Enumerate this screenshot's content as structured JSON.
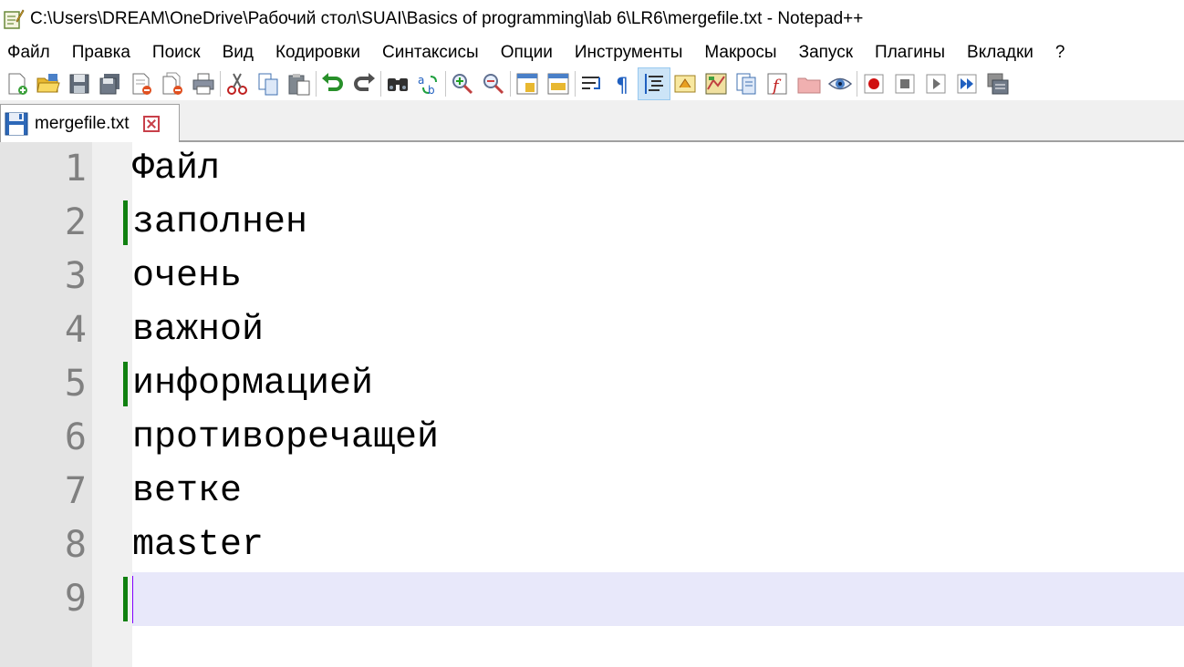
{
  "window": {
    "title": "C:\\Users\\DREAM\\OneDrive\\Рабочий стол\\SUAI\\Basics of programming\\lab 6\\LR6\\mergefile.txt - Notepad++"
  },
  "menu": [
    "Файл",
    "Правка",
    "Поиск",
    "Вид",
    "Кодировки",
    "Синтаксисы",
    "Опции",
    "Инструменты",
    "Макросы",
    "Запуск",
    "Плагины",
    "Вкладки",
    "?"
  ],
  "toolbar": {
    "buttons": [
      "new-file",
      "open-file",
      "save",
      "save-all",
      "close",
      "close-all",
      "print",
      "cut",
      "copy",
      "paste",
      "undo",
      "redo",
      "find",
      "replace",
      "zoom-in",
      "zoom-out",
      "sync-vertical",
      "sync-horizontal",
      "word-wrap",
      "show-all-characters",
      "indent-guide",
      "user-defined-language",
      "document-map",
      "document-list",
      "function-list",
      "folder-as-workspace",
      "monitoring",
      "record-macro",
      "stop-recording",
      "play-macro",
      "run-macro-multiple",
      "save-macro"
    ],
    "active_button": "indent-guide"
  },
  "tab": {
    "label": "mergefile.txt"
  },
  "editor": {
    "line_numbers": [
      "1",
      "2",
      "3",
      "4",
      "5",
      "6",
      "7",
      "8",
      "9"
    ],
    "lines": [
      "Файл",
      "заполнен",
      "очень",
      "важной",
      "информацией",
      "противоречащей",
      "ветке",
      "master",
      ""
    ],
    "changed_lines": [
      2,
      5,
      9
    ],
    "current_line": 9,
    "colors": {
      "change_marker": "#108010",
      "current_line_bg": "#e8e8fa",
      "caret": "#8000ff"
    }
  }
}
